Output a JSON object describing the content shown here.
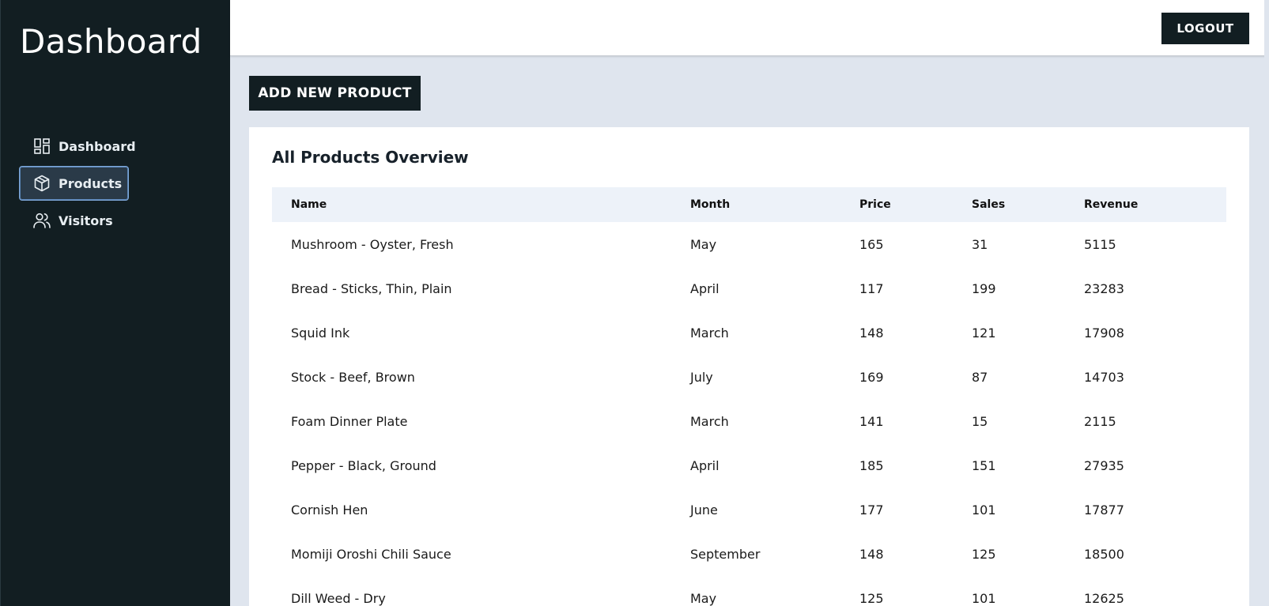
{
  "sidebar": {
    "brand": "Dashboard",
    "items": [
      {
        "label": "Dashboard",
        "icon": "dashboard-grid-icon",
        "active": false
      },
      {
        "label": "Products",
        "icon": "package-box-icon",
        "active": true
      },
      {
        "label": "Visitors",
        "icon": "users-icon",
        "active": false
      }
    ]
  },
  "topbar": {
    "logout_label": "LOGOUT"
  },
  "main": {
    "add_button_label": "ADD NEW PRODUCT",
    "card_title": "All Products Overview",
    "columns": [
      "Name",
      "Month",
      "Price",
      "Sales",
      "Revenue"
    ],
    "rows": [
      {
        "name": "Mushroom - Oyster, Fresh",
        "month": "May",
        "price": "165",
        "sales": "31",
        "revenue": "5115"
      },
      {
        "name": "Bread - Sticks, Thin, Plain",
        "month": "April",
        "price": "117",
        "sales": "199",
        "revenue": "23283"
      },
      {
        "name": "Squid Ink",
        "month": "March",
        "price": "148",
        "sales": "121",
        "revenue": "17908"
      },
      {
        "name": "Stock - Beef, Brown",
        "month": "July",
        "price": "169",
        "sales": "87",
        "revenue": "14703"
      },
      {
        "name": "Foam Dinner Plate",
        "month": "March",
        "price": "141",
        "sales": "15",
        "revenue": "2115"
      },
      {
        "name": "Pepper - Black, Ground",
        "month": "April",
        "price": "185",
        "sales": "151",
        "revenue": "27935"
      },
      {
        "name": "Cornish Hen",
        "month": "June",
        "price": "177",
        "sales": "101",
        "revenue": "17877"
      },
      {
        "name": "Momiji Oroshi Chili Sauce",
        "month": "September",
        "price": "148",
        "sales": "125",
        "revenue": "18500"
      },
      {
        "name": "Dill Weed - Dry",
        "month": "May",
        "price": "125",
        "sales": "101",
        "revenue": "12625"
      }
    ]
  },
  "colors": {
    "sidebar_bg": "#121e22",
    "page_bg": "#dfe5ee",
    "table_header_bg": "#edf2f9",
    "active_border": "#7ea7d8"
  }
}
